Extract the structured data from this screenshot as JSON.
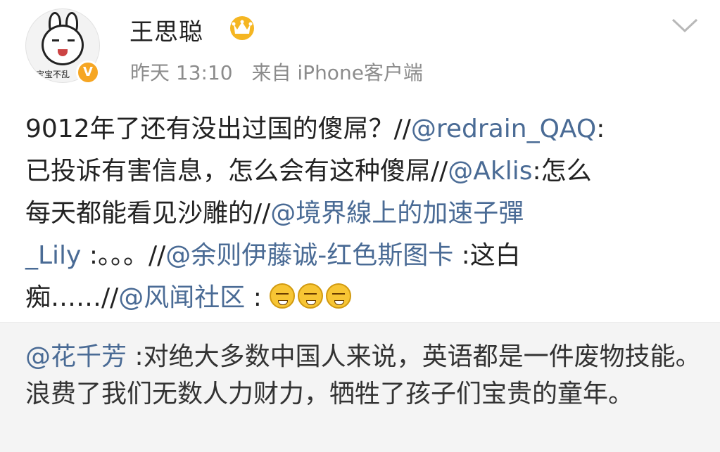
{
  "post": {
    "author": {
      "name": "王思聪",
      "avatar_caption": "宝宝不乱",
      "verified_mark": "V"
    },
    "meta": {
      "time": "昨天 13:10",
      "source": "来自 iPhone客户端"
    },
    "text": {
      "line1_plain": "9012年了还有没出过国的傻屌？//",
      "line1_mention": "@redrain_QAQ",
      "line1_tail": ":",
      "line2_plain": "已投诉有害信息，怎么会有这种傻屌//",
      "line2_mention": "@Aklis",
      "line2_tail": ":怎么",
      "line3_plain": "每天都能看见沙雕的//",
      "line3_mention": "@境界線上的加速子彈",
      "line4_mention": "_Lily",
      "line4_mid": " :。。。//",
      "line4_mention2": "@余则伊藤诚-红色斯图卡",
      "line4_tail": " :这白",
      "line5_plain": "痴……//",
      "line5_mention": "@风闻社区",
      "line5_tail": " : "
    },
    "emojis": [
      "sleepy-face-icon",
      "sleepy-face-icon",
      "sleepy-face-icon"
    ]
  },
  "repost": {
    "mention": "@花千芳",
    "text": " :对绝大多数中国人来说，英语都是一件废物技能。浪费了我们无数人力财力，牺牲了孩子们宝贵的童年。"
  },
  "colors": {
    "mention": "#4a6b95",
    "meta": "#8c8c8c",
    "repost_bg": "#f4f4f4",
    "verified": "#f6a623"
  }
}
